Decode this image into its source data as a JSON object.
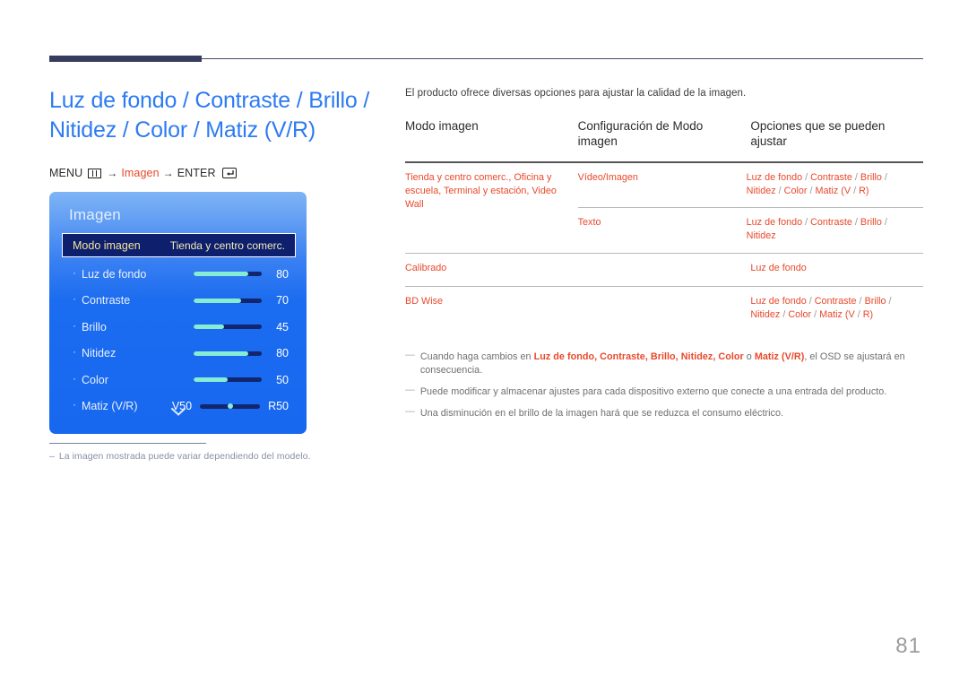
{
  "page": {
    "number": "81"
  },
  "left": {
    "title": "Luz de fondo / Contraste / Brillo / Nitidez / Color / Matiz (V/R)",
    "menu_path": {
      "menu_label": "MENU",
      "menu_icon": "menu-grid-icon",
      "arrow1": "→",
      "target": "Imagen",
      "arrow2": "→",
      "enter_label": "ENTER",
      "enter_icon": "enter-key-icon"
    },
    "footnote": {
      "dash": "–",
      "text": "La imagen mostrada puede variar dependiendo del modelo."
    }
  },
  "osd": {
    "title": "Imagen",
    "selected_row": {
      "label": "Modo imagen",
      "value": "Tienda y centro comerc."
    },
    "rows": [
      {
        "label": "Luz de fondo",
        "value": "80",
        "fill_pct": 80
      },
      {
        "label": "Contraste",
        "value": "70",
        "fill_pct": 70
      },
      {
        "label": "Brillo",
        "value": "45",
        "fill_pct": 45
      },
      {
        "label": "Nitidez",
        "value": "80",
        "fill_pct": 80
      },
      {
        "label": "Color",
        "value": "50",
        "fill_pct": 50
      }
    ],
    "range_row": {
      "label": "Matiz (V/R)",
      "left_value": "V50",
      "right_value": "R50",
      "knob_pct": 50
    },
    "chevron_icon": "chevron-down-icon",
    "colors": {
      "panel_blue": "#1768ef",
      "selected_bg": "#0e1f6e",
      "selected_text": "#f2e59a",
      "slider_fill": "#86ecd4",
      "slider_track": "#11266f"
    }
  },
  "right": {
    "intro": "El producto ofrece diversas opciones para ajustar la calidad de la imagen.",
    "table": {
      "headers": [
        "Modo imagen",
        "Configuración de Modo imagen",
        "Opciones que se pueden ajustar"
      ],
      "rows": [
        {
          "mode": "Tienda y centro comerc., Oficina y escuela, Terminal y estación, Video Wall",
          "subrows": [
            {
              "config": "Vídeo/Imagen",
              "options": "Luz de fondo / Contraste / Brillo / Nitidez / Color / Matiz (V/R)"
            },
            {
              "config": "Texto",
              "options": "Luz de fondo / Contraste / Brillo / Nitidez"
            }
          ]
        },
        {
          "mode": "Calibrado",
          "config": "",
          "options": "Luz de fondo"
        },
        {
          "mode": "BD Wise",
          "config": "",
          "options": "Luz de fondo / Contraste / Brillo / Nitidez / Color / Matiz (V/R)"
        }
      ]
    },
    "notes": [
      {
        "dash": "—",
        "prefix": "Cuando haga cambios en ",
        "terms": "Luz de fondo, Contraste, Brillo, Nitidez, Color",
        "mid": " o ",
        "term2": "Matiz (V/R)",
        "suffix": ", el OSD se ajustará en consecuencia."
      },
      {
        "dash": "—",
        "text": "Puede modificar y almacenar ajustes para cada dispositivo externo que conecte a una entrada del producto."
      },
      {
        "dash": "—",
        "text": "Una disminución en el brillo de la imagen hará que se reduzca el consumo eléctrico."
      }
    ]
  }
}
